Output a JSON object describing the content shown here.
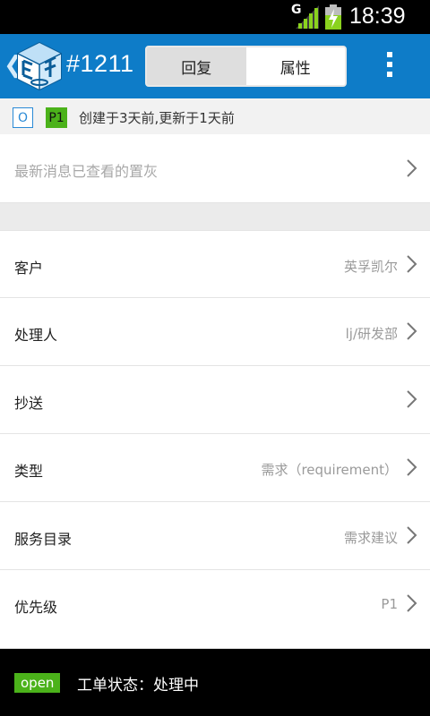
{
  "status_bar": {
    "network": "G",
    "time": "18:39"
  },
  "app_bar": {
    "ticket_number": "#1211",
    "tabs": [
      {
        "label": "回复",
        "selected": false
      },
      {
        "label": "属性",
        "selected": true
      }
    ]
  },
  "info": {
    "state_badge": "O",
    "priority_badge": "P1",
    "text": "创建于3天前,更新于1天前"
  },
  "hint_row": {
    "label": "最新消息已查看的置灰"
  },
  "fields": [
    {
      "label": "客户",
      "value": "英孚凯尔"
    },
    {
      "label": "处理人",
      "value": "lj/研发部"
    },
    {
      "label": "抄送",
      "value": ""
    },
    {
      "label": "类型",
      "value": "需求（requirement）"
    },
    {
      "label": "服务目录",
      "value": "需求建议"
    },
    {
      "label": "优先级",
      "value": "P1"
    }
  ],
  "bottom_bar": {
    "status_badge": "open",
    "status_text": "工单状态：处理中"
  },
  "colors": {
    "app_bar": "#0e7cc8",
    "badge_green": "#4bb21a",
    "badge_blue": "#2a8ad6"
  }
}
